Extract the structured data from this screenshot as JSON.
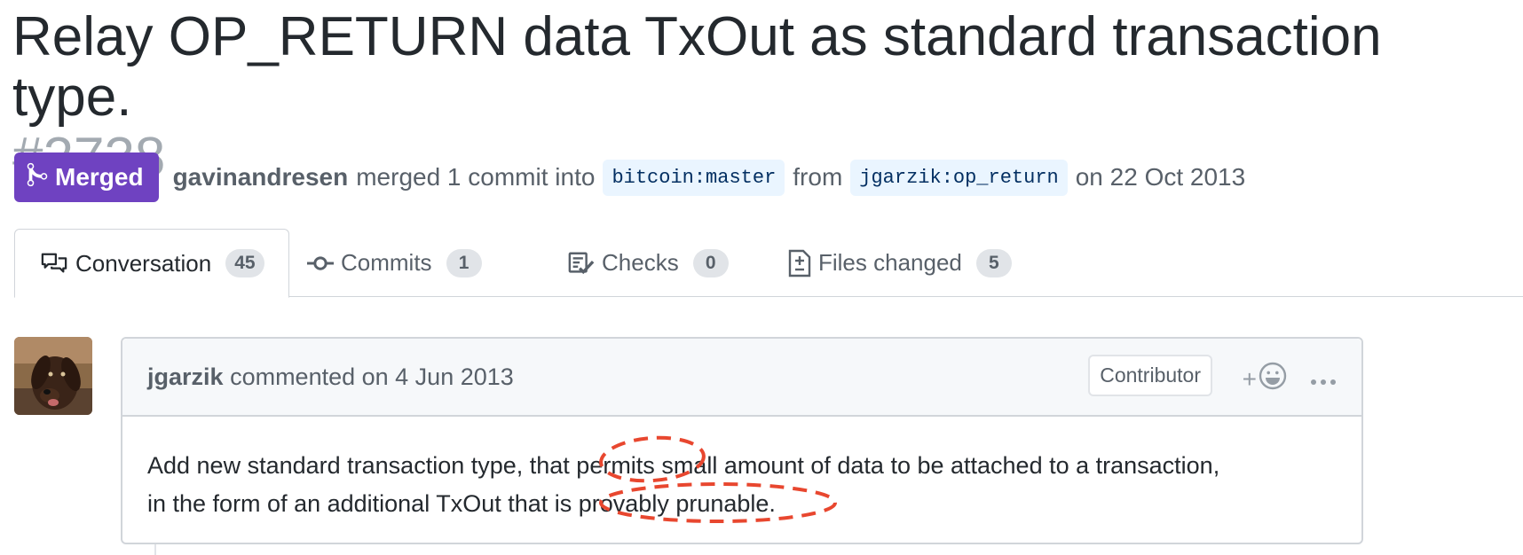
{
  "pr": {
    "title": "Relay OP_RETURN data TxOut as standard transaction type.",
    "number": "#2738"
  },
  "state": {
    "label": "Merged",
    "icon": "git-merge-icon",
    "color": "#6f42c1"
  },
  "meta": {
    "author": "gavinandresen",
    "merged_text": "merged 1 commit into",
    "base_branch": "bitcoin:master",
    "from_text": "from",
    "head_branch": "jgarzik:op_return",
    "date_text": "on 22 Oct 2013"
  },
  "tabs": [
    {
      "label": "Conversation",
      "count": "45",
      "icon": "comment-discussion-icon"
    },
    {
      "label": "Commits",
      "count": "1",
      "icon": "git-commit-icon"
    },
    {
      "label": "Checks",
      "count": "0",
      "icon": "checklist-icon"
    },
    {
      "label": "Files changed",
      "count": "5",
      "icon": "file-diff-icon"
    }
  ],
  "comment": {
    "author": "jgarzik",
    "action_text": "commented on 4 Jun 2013",
    "role_badge": "Contributor",
    "react_plus": "+",
    "body_line1": "Add new standard transaction type, that permits small amount of data to be attached to a transaction,",
    "body_line2": "in the form of an additional TxOut that is provably prunable."
  },
  "colors": {
    "annotation": "#e8472f",
    "text": "#24292e",
    "muted": "#586069",
    "border": "#d1d5da"
  }
}
